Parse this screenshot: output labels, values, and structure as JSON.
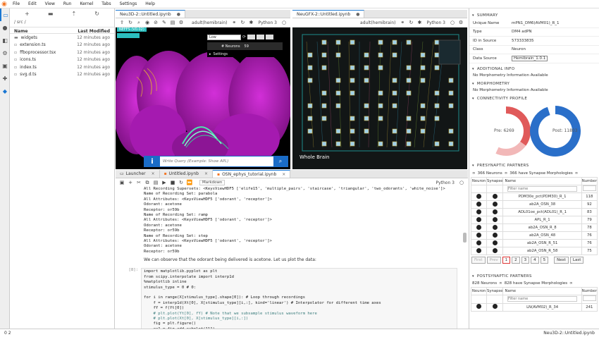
{
  "menu": {
    "items": [
      "File",
      "Edit",
      "View",
      "Run",
      "Kernel",
      "Tabs",
      "Settings",
      "Help"
    ]
  },
  "filebrowser": {
    "breadcrumb": "/ src /",
    "col_name": "Name",
    "col_modified": "Last Modified",
    "files": [
      {
        "name": "widgets",
        "modified": "12 minutes ago",
        "icon": "folder-icon"
      },
      {
        "name": "extension.ts",
        "modified": "12 minutes ago",
        "icon": "file-icon"
      },
      {
        "name": "ffboprocessor.tsx",
        "modified": "12 minutes ago",
        "icon": "file-icon"
      },
      {
        "name": "icons.ts",
        "modified": "12 minutes ago",
        "icon": "file-icon"
      },
      {
        "name": "index.ts",
        "modified": "12 minutes ago",
        "icon": "file-icon"
      },
      {
        "name": "svg.d.ts",
        "modified": "12 minutes ago",
        "icon": "file-icon"
      }
    ]
  },
  "neu3d": {
    "tab": "Neu3D-2::Untitled.ipynb",
    "kernel_name": "adult(hemibrain)",
    "kernel": "Python 3",
    "corner_label": "NEFFS (V0.02)",
    "quality_value": "Low",
    "neurons_label": "# Neurons",
    "neurons_count": "59",
    "settings_label": "Settings",
    "search_placeholder": "Write Query (Example: Show APL)"
  },
  "neugfx": {
    "tab": "NeuGFX-2::Untitled.ipynb",
    "kernel_name": "adult(hemibrain)",
    "kernel": "Python 3",
    "label": "Whole Brain"
  },
  "bottom_tabs": [
    "Launcher",
    "Untitled.ipynb",
    "OSN_ephys_tutorial.ipynb"
  ],
  "notebook": {
    "cell_type": "Markdown",
    "kernel": "Python 3",
    "output_lines": [
      "All Recording Supersets: <KeysViewHDF5 ['elife15', 'multiple_pairs', 'staircase', 'triangular', 'two_odorants', 'white_noise']>",
      "Name of Recording Set: parabola",
      "All Attributes: <KeysViewHDF5 ['odorant', 'receptor']>",
      "Odorant: acetone",
      "Receptor: or59b",
      "Name of Recording Set: ramp",
      "All Attributes: <KeysViewHDF5 ['odorant', 'receptor']>",
      "Odorant: acetone",
      "Receptor: or59b",
      "Name of Recording Set: step",
      "All Attributes: <KeysViewHDF5 ['odorant', 'receptor']>",
      "Odorant: acetone",
      "Receptor: or59b"
    ],
    "markdown": "We can observe that the odorant being delivered is acetone. Let us plot the data:",
    "prompt": "[8]:",
    "code_lines": [
      "import matplotlib.pyplot as plt",
      "from scipy.interpolate import interp1d",
      "%matplotlib inline",
      "stimulus_type = 0 # 0:",
      "",
      "for i in range(X[stimulus_type].shape[0]): # Loop through recordings",
      "    f = interp1d(Xt[0], X[stimulus_type][i,:], kind='linear') # Interpolator for different time axes",
      "    fY = f(Yt[0])",
      "    # plt.plot(Yt[0], fY) # Note that we subsample stimulus waveform here",
      "    # plt.plot(Xt[0], X[stimulus_type][i,:])",
      "    fig = plt.figure()",
      "    ax1 = fig.add_subplot(111)"
    ]
  },
  "summary": {
    "title": "SUMMARY",
    "rows": [
      {
        "k": "Unique Name",
        "v": "mPN1_DM6(AVM01)_R_1"
      },
      {
        "k": "Type",
        "v": "DM4 adPN"
      },
      {
        "k": "ID in Source",
        "v": "573333835"
      },
      {
        "k": "Class",
        "v": "Neuron"
      },
      {
        "k": "Data Source",
        "v": "Hemibrain_1.0.1"
      }
    ]
  },
  "additional_info": {
    "title": "ADDITIONAL INFO",
    "text": "No Morphometry Information Available"
  },
  "morphometry": {
    "title": "MORPHOMETRY",
    "text": "No Morphometry Information Available"
  },
  "connectivity": {
    "title": "CONNECTIVITY PROFILE",
    "pre_label": "Pre: 6269",
    "post_label": "Post: 11803",
    "pre_fraction": 0.35,
    "post_fraction": 0.95,
    "pre_color": "#e05a5a",
    "post_color": "#2a6fc9"
  },
  "presynaptic": {
    "title": "PRESYNAPTIC PARTNERS",
    "neurons": "366 Neurons",
    "morph": "366 have Synapse Morphologies",
    "col_neuron": "Neuron",
    "col_synapse": "Synapse",
    "col_name": "Name",
    "col_number": "Number",
    "filter_placeholder": "Filter name",
    "rows": [
      {
        "name": "PDM30e_pct(PDM30)_R_1",
        "number": "118"
      },
      {
        "name": "ab2A_OSN_38",
        "number": "92"
      },
      {
        "name": "ADL01oe_pct(ADL01)_R_1",
        "number": "83"
      },
      {
        "name": "APL_R_1",
        "number": "79"
      },
      {
        "name": "ab2A_OSN_R_8",
        "number": "78"
      },
      {
        "name": "ab2A_OSN_48",
        "number": "76"
      },
      {
        "name": "ab2A_OSN_R_51",
        "number": "76"
      },
      {
        "name": "ab2A_OSN_R_58",
        "number": "75"
      }
    ],
    "pages": [
      "First",
      "Prev",
      "1",
      "2",
      "3",
      "4",
      "5",
      "Next",
      "Last"
    ]
  },
  "postsynaptic": {
    "title": "POSTSYNAPTIC PARTNERS",
    "neurons": "828 Neurons",
    "morph": "828 have Synapse Morphologies",
    "col_neuron": "Neuron",
    "col_synapse": "Synapse",
    "col_name": "Name",
    "col_number": "Number",
    "filter_placeholder": "Filter name",
    "rows": [
      {
        "name": "LN(AVM02)_R_34",
        "number": "241"
      }
    ]
  },
  "status": {
    "left": "0   2",
    "right": "Neu3D-2::Untitled.ipynb"
  }
}
